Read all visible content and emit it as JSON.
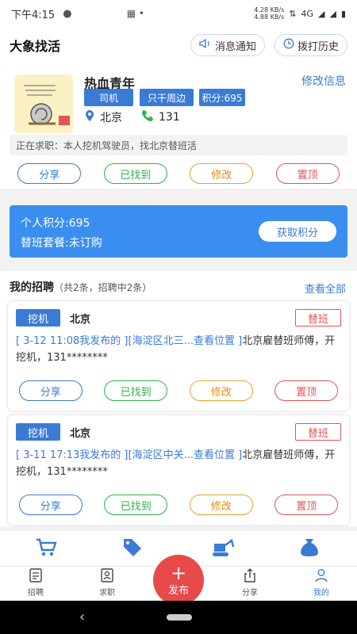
{
  "status": {
    "time": "下午4:15",
    "speed_up": "4.28 KB/s",
    "speed_down": "4.88 KB/s",
    "network": "4G"
  },
  "header": {
    "title": "大象找活",
    "notify_label": "消息通知",
    "history_label": "拨打历史"
  },
  "profile": {
    "name": "热血青年",
    "edit_label": "修改信息",
    "tags": [
      "司机",
      "只干周边",
      "积分:695"
    ],
    "location": "北京",
    "phone": "131",
    "seeking": "正在求职：本人挖机驾驶员，找北京替班活",
    "actions": [
      "分享",
      "已找到",
      "修改",
      "置顶"
    ]
  },
  "points": {
    "personal": "个人积分:695",
    "package": "替班套餐:未订购",
    "get_label": "获取积分"
  },
  "recruit": {
    "title": "我的招聘",
    "subtitle": "（共2条，招聘中2条）",
    "view_all": "查看全部",
    "jobs": [
      {
        "tag": "挖机",
        "city": "北京",
        "type": "替班",
        "time_part": "[ 3-12 11:08我发布的 ]",
        "loc_part": "[海淀区北三...查看位置 ]",
        "desc": "北京雇替班师傅，开挖机，131********"
      },
      {
        "tag": "挖机",
        "city": "北京",
        "type": "替班",
        "time_part": "[ 3-11 17:13我发布的 ]",
        "loc_part": "[海淀区中关...查看位置 ]",
        "desc": "北京雇替班师傅，开挖机，131********"
      }
    ],
    "actions": [
      "分享",
      "已找到",
      "修改",
      "置顶"
    ]
  },
  "tabbar": {
    "items": [
      "招聘",
      "求职",
      "分享",
      "我的"
    ],
    "publish": "发布"
  },
  "colors": {
    "accent": "#3a7bd5",
    "publish": "#e84a4a"
  }
}
